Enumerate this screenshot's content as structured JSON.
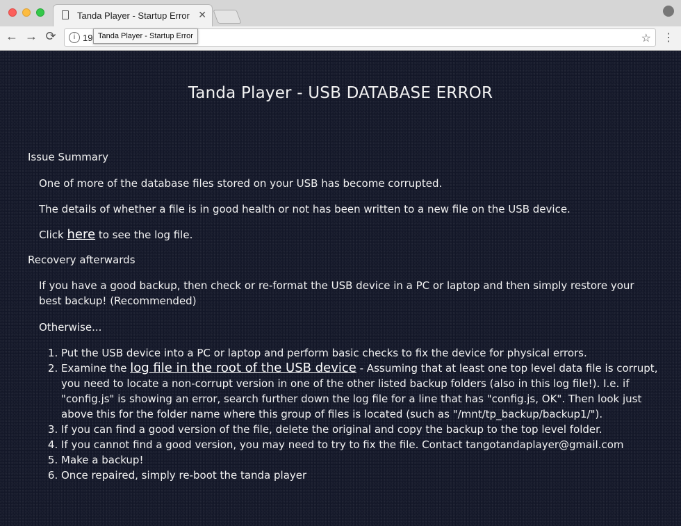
{
  "browser": {
    "tab_title": "Tanda Player - Startup Error",
    "tab_close": "✕",
    "url_partial": "19",
    "tooltip": "Tanda Player - Startup Error",
    "icons": {
      "back": "←",
      "forward": "→",
      "reload": "⟳",
      "info": "i",
      "star": "☆",
      "menu": "⋮"
    }
  },
  "page": {
    "heading": "Tanda Player - USB DATABASE ERROR",
    "issue_summary": {
      "title": "Issue Summary",
      "p1": "One of more of the database files stored on your USB has become corrupted.",
      "p2": "The details of whether a file is in good health or not has been written to a new file on the USB device.",
      "click_prefix": "Click ",
      "click_link": "here",
      "click_suffix": " to see the log file."
    },
    "recovery": {
      "title": "Recovery afterwards",
      "p1": "If you have a good backup, then check or re-format the USB device in a PC or laptop and then simply restore your best backup! (Recommended)",
      "p2": "Otherwise...",
      "steps": [
        {
          "text": "Put the USB device into a PC or laptop and perform basic checks to fix the device for physical errors."
        },
        {
          "prefix": "Examine the ",
          "link": "log file in the root of the USB device",
          "suffix": " - Assuming that at least one top level data file is corrupt, you need to locate a non-corrupt version in one of the other listed backup folders (also in this log file!). I.e. if \"config.js\" is showing an error, search further down the log file for a line that has \"config.js, OK\". Then look just above this for the folder name where this group of files is located (such as \"/mnt/tp_backup/backup1/\")."
        },
        {
          "text": "If you can find a good version of the file, delete the original and copy the backup to the top level folder."
        },
        {
          "text": "If you cannot find a good version, you may need to try to fix the file. Contact tangotandaplayer@gmail.com"
        },
        {
          "text": "Make a backup!"
        },
        {
          "text": "Once repaired, simply re-boot the tanda player"
        }
      ]
    }
  }
}
